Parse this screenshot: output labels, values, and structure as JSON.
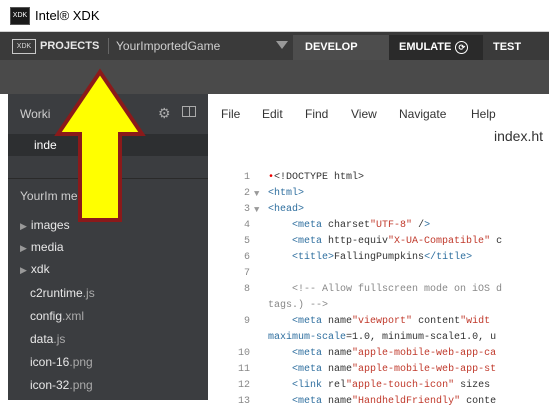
{
  "window": {
    "title": "Intel® XDK",
    "logo_text": "XDK"
  },
  "toolbar": {
    "projects_icon": "XDK",
    "projects_label": "PROJECTS",
    "project_name": "YourImportedGame",
    "tabs": [
      {
        "label": "DEVELOP",
        "active": true
      },
      {
        "label": "EMULATE",
        "icon": "⟳"
      },
      {
        "label": "TEST"
      }
    ]
  },
  "sidebar": {
    "working_label": "Worki",
    "open_file": "inde",
    "project_label": "YourIm                me",
    "folders": [
      "images",
      "media",
      "xdk"
    ],
    "files": [
      {
        "name": "c2runtime",
        "ext": ".js"
      },
      {
        "name": "config",
        "ext": ".xml"
      },
      {
        "name": "data",
        "ext": ".js"
      },
      {
        "name": "icon-16",
        "ext": ".png"
      },
      {
        "name": "icon-32",
        "ext": ".png"
      }
    ]
  },
  "editor": {
    "menu": [
      "File",
      "Edit",
      "Find",
      "View",
      "Navigate",
      "Help"
    ],
    "file_tab": "index.ht",
    "line_numbers": [
      "1",
      "2",
      "3",
      "4",
      "5",
      "6",
      "7",
      "8",
      "",
      "9",
      "",
      "10",
      "11",
      "12",
      "13"
    ],
    "lines": [
      "<!DOCTYPE html>",
      "<html>",
      "<head>",
      "    <meta charset=\"UTF-8\" />",
      "    <meta http-equiv=\"X-UA-Compatible\" c",
      "    <title>FallingPumpkins</title>",
      "",
      "    <!-- Allow fullscreen mode on iOS d",
      "tags.) -->",
      "    <meta name=\"viewport\" content=\"widt",
      "maximum-scale=1.0, minimum-scale=1.0, u",
      "    <meta name=\"apple-mobile-web-app-ca",
      "    <meta name=\"apple-mobile-web-app-st",
      "    <link rel=\"apple-touch-icon\" sizes=",
      "    <meta name=\"HandheldFriendly\" conte"
    ]
  },
  "colors": {
    "arrow_fill": "#ffff00",
    "arrow_stroke": "#8b1a1a",
    "toolbar": "#3a3a3a",
    "sidebar": "#3b3d40"
  }
}
